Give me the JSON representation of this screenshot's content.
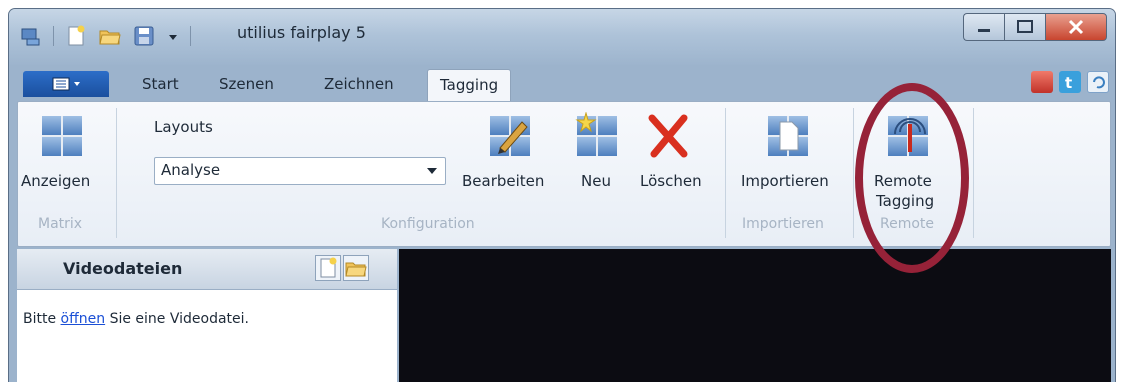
{
  "window": {
    "title": "utilius fairplay 5"
  },
  "tabs": [
    {
      "label": "Start"
    },
    {
      "label": "Szenen"
    },
    {
      "label": "Zeichnen"
    },
    {
      "label": "Tagging",
      "active": true
    }
  ],
  "ribbon": {
    "matrix": {
      "button_label": "Anzeigen",
      "group_label": "Matrix"
    },
    "konfiguration": {
      "layouts_label": "Layouts",
      "layout_value": "Analyse",
      "edit_label": "Bearbeiten",
      "new_label": "Neu",
      "delete_label": "Löschen",
      "group_label": "Konfiguration"
    },
    "importieren": {
      "button_label": "Importieren",
      "group_label": "Importieren"
    },
    "remote": {
      "button_label_1": "Remote",
      "button_label_2": "Tagging",
      "group_label": "Remote"
    }
  },
  "left_panel": {
    "title": "Videodateien",
    "msg_before": "Bitte ",
    "msg_link": "öffnen",
    "msg_after": " Sie eine Videodatei."
  },
  "colors": {
    "annotation_circle": "#962238",
    "video_background": "#0c0c12",
    "app_menu": "#2c6ec8"
  },
  "icons": {
    "qat": [
      "app-icon",
      "new-file-icon",
      "open-folder-icon",
      "save-icon",
      "qat-dropdown-icon"
    ],
    "window_controls": [
      "minimize-icon",
      "maximize-icon",
      "close-icon"
    ],
    "top_right": [
      "youtube-icon",
      "twitter-icon",
      "refresh-icon"
    ]
  }
}
